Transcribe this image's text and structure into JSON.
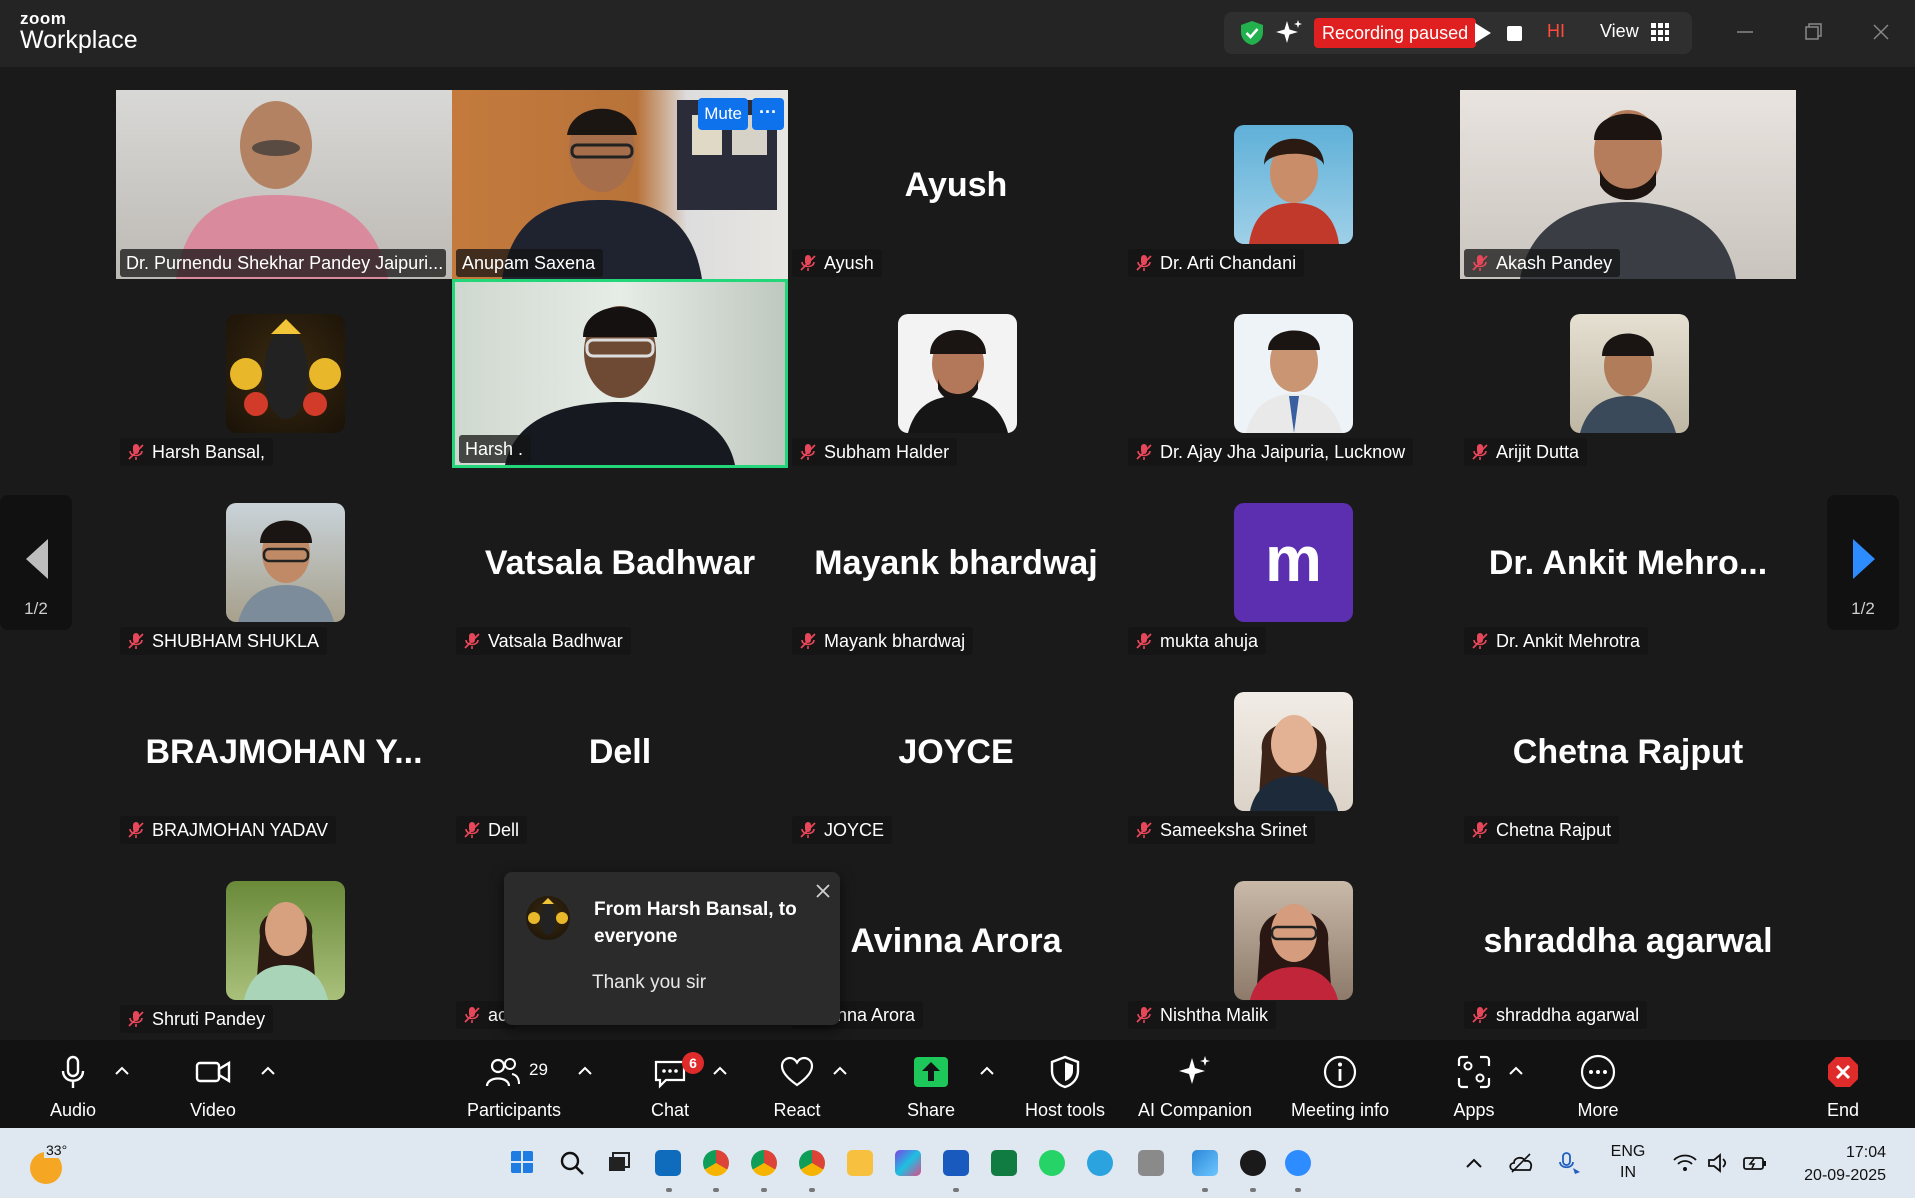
{
  "app": {
    "brand_top": "zoom",
    "brand_bottom": "Workplace"
  },
  "recording": {
    "status": "Recording paused",
    "hi": "HI",
    "view_label": "View"
  },
  "tiles": [
    {
      "tag": "Dr. Purnendu Shekhar Pandey Jaipuri...",
      "big": ""
    },
    {
      "tag": "Anupam Saxena",
      "big": "",
      "mute": "Mute",
      "more": "···"
    },
    {
      "tag": "Ayush",
      "big": "Ayush"
    },
    {
      "tag": "Dr. Arti Chandani",
      "big": ""
    },
    {
      "tag": "Akash Pandey",
      "big": ""
    },
    {
      "tag": "Harsh Bansal,",
      "big": ""
    },
    {
      "tag": "Harsh .",
      "big": ""
    },
    {
      "tag": "Subham Halder",
      "big": ""
    },
    {
      "tag": "Dr. Ajay Jha Jaipuria, Lucknow",
      "big": ""
    },
    {
      "tag": "Arijit Dutta",
      "big": ""
    },
    {
      "tag": "SHUBHAM SHUKLA",
      "big": ""
    },
    {
      "tag": "Vatsala Badhwar",
      "big": "Vatsala Badhwar"
    },
    {
      "tag": "Mayank bhardwaj",
      "big": "Mayank bhardwaj"
    },
    {
      "tag": "mukta ahuja",
      "big": "",
      "letter": "m"
    },
    {
      "tag": "Dr. Ankit Mehrotra",
      "big": "Dr. Ankit Mehro..."
    },
    {
      "tag": "BRAJMOHAN YADAV",
      "big": "BRAJMOHAN Y..."
    },
    {
      "tag": "Dell",
      "big": "Dell"
    },
    {
      "tag": "JOYCE",
      "big": "JOYCE"
    },
    {
      "tag": "Sameeksha Srinet",
      "big": ""
    },
    {
      "tag": "Chetna Rajput",
      "big": "Chetna Rajput"
    },
    {
      "tag": "Shruti Pandey",
      "big": ""
    },
    {
      "tag": "ac",
      "big": ""
    },
    {
      "tag": "vinna Arora",
      "big": "Avinna Arora"
    },
    {
      "tag": "Nishtha Malik",
      "big": ""
    },
    {
      "tag": "shraddha agarwal",
      "big": "shraddha agarwal"
    }
  ],
  "pagination": {
    "left": "1/2",
    "right": "1/2"
  },
  "chat_popup": {
    "title": "From Harsh Bansal, to everyone",
    "message": "Thank you sir"
  },
  "toolbar": {
    "audio": "Audio",
    "video": "Video",
    "participants": "Participants",
    "participants_count": "29",
    "chat": "Chat",
    "chat_badge": "6",
    "react": "React",
    "share": "Share",
    "host_tools": "Host tools",
    "ai_companion": "AI Companion",
    "meeting_info": "Meeting info",
    "apps": "Apps",
    "more": "More",
    "end": "End"
  },
  "taskbar": {
    "temperature": "33°",
    "lang_top": "ENG",
    "lang_bottom": "IN",
    "time": "17:04",
    "date": "20-09-2025"
  },
  "colors": {
    "accent": "#0e72ed",
    "recording": "#e02020",
    "active_speaker": "#23d67a",
    "end": "#e02b2b"
  }
}
